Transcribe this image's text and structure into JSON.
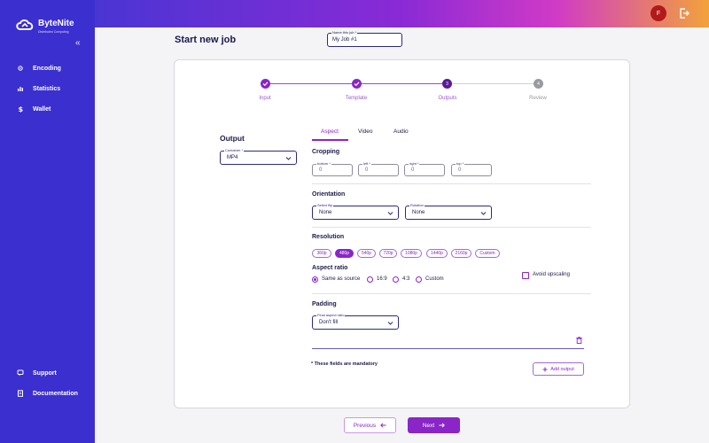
{
  "brand": {
    "name": "ByteNite",
    "tagline": "Distributed Computing"
  },
  "sidebar": {
    "collapse_glyph": "«",
    "items": [
      {
        "label": "Encoding",
        "icon": "encoding-icon"
      },
      {
        "label": "Statistics",
        "icon": "statistics-icon"
      },
      {
        "label": "Wallet",
        "icon": "dollar-icon"
      },
      {
        "label": "Support",
        "icon": "support-icon"
      },
      {
        "label": "Documentation",
        "icon": "document-icon"
      }
    ]
  },
  "header": {
    "avatar_initial": "F"
  },
  "page": {
    "title": "Start new job",
    "job_name_label": "Name this job *",
    "job_name_value": "My Job #1"
  },
  "stepper": {
    "steps": [
      {
        "label": "Input",
        "state": "done",
        "marker": ""
      },
      {
        "label": "Template",
        "state": "done",
        "marker": ""
      },
      {
        "label": "Outputs",
        "state": "current",
        "marker": "3"
      },
      {
        "label": "Review",
        "state": "pending",
        "marker": "4"
      }
    ]
  },
  "output": {
    "heading": "Output",
    "container_label": "Container *",
    "container_value": "MP4"
  },
  "tabs": [
    "Aspect",
    "Video",
    "Audio"
  ],
  "cropping": {
    "heading": "Cropping",
    "fields": [
      {
        "label": "bottom *",
        "value": "0"
      },
      {
        "label": "left *",
        "value": "0"
      },
      {
        "label": "right *",
        "value": "0"
      },
      {
        "label": "top *",
        "value": "0"
      }
    ]
  },
  "orientation": {
    "heading": "Orientation",
    "flip_label": "Select flip",
    "flip_value": "None",
    "rotation_label": "Rotation",
    "rotation_value": "None"
  },
  "resolution": {
    "heading": "Resolution",
    "options": [
      "360p",
      "480p",
      "540p",
      "720p",
      "1080p",
      "1440p",
      "2160p",
      "Custom"
    ],
    "selected": "480p"
  },
  "aspect_ratio": {
    "heading": "Aspect ratio",
    "options": [
      "Same as source",
      "16:9",
      "4:3",
      "Custom"
    ],
    "selected": "Same as source",
    "avoid_upscaling_label": "Avoid upscaling"
  },
  "padding": {
    "heading": "Padding",
    "fill_label": "Final aspect ratio",
    "fill_value": "Don't fill"
  },
  "footer": {
    "mandatory_note": "* These fields are mandatory",
    "add_output_label": "Add output",
    "previous_label": "Previous",
    "next_label": "Next"
  },
  "colors": {
    "accent": "#8a25c8",
    "sidebar": "#3b2fd0"
  }
}
